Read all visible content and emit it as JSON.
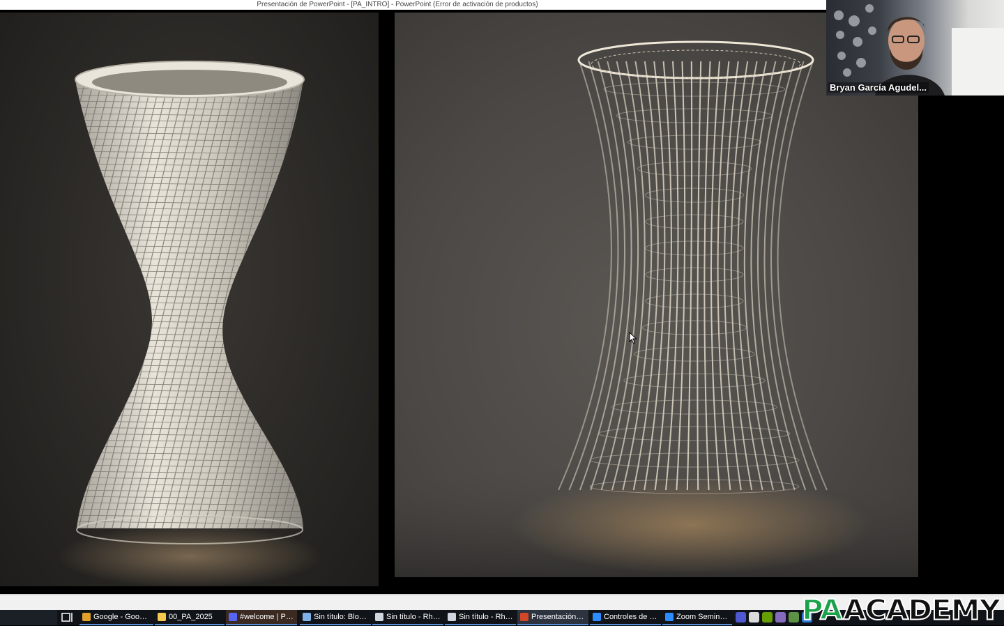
{
  "window": {
    "title": "Presentación de PowerPoint - [PA_INTRO] - PowerPoint (Error de activación de productos)"
  },
  "slide": {
    "left_image": "white ribbed twisted hyperboloid vase render",
    "right_image": "lattice hyperboloid vase render with diagonal struts"
  },
  "video": {
    "participant_name": "Bryan García Agudel..."
  },
  "taskbar": {
    "items": [
      {
        "label": "Google - Googl...",
        "icon": "chrome-icon",
        "color": "#e0a02a"
      },
      {
        "label": "00_PA_2025",
        "icon": "folder-icon",
        "color": "#f2c94c"
      },
      {
        "label": "#welcome | Par...",
        "icon": "discord-icon",
        "color": "#5865f2"
      },
      {
        "label": "Sin título: Bloc ...",
        "icon": "notepad-icon",
        "color": "#7fb3e8"
      },
      {
        "label": "Sin título - Rhi...",
        "icon": "rhino-icon",
        "color": "#cfd6de"
      },
      {
        "label": "Sin título - Rhi...",
        "icon": "rhino-icon",
        "color": "#cfd6de"
      },
      {
        "label": "Presentación d...",
        "icon": "powerpoint-icon",
        "color": "#d24726"
      },
      {
        "label": "Controles de re...",
        "icon": "zoom-icon",
        "color": "#2d8cff"
      },
      {
        "label": "Zoom Seminari...",
        "icon": "zoom-icon",
        "color": "#2d8cff"
      }
    ],
    "tray_icons": [
      {
        "icon": "discord-tray-icon",
        "color": "#5865f2"
      },
      {
        "icon": "google-tray-icon",
        "color": "#ffffff"
      },
      {
        "icon": "nvidia-tray-icon",
        "color": "#76b900"
      },
      {
        "icon": "pen-tray-icon",
        "color": "#9b7ad8"
      },
      {
        "icon": "app-tray-icon",
        "color": "#6aa84f"
      },
      {
        "icon": "zoom-tray-icon",
        "color": "#2d8cff"
      }
    ]
  },
  "watermark": {
    "pa": "PA",
    "academy": "ACADEMY"
  }
}
